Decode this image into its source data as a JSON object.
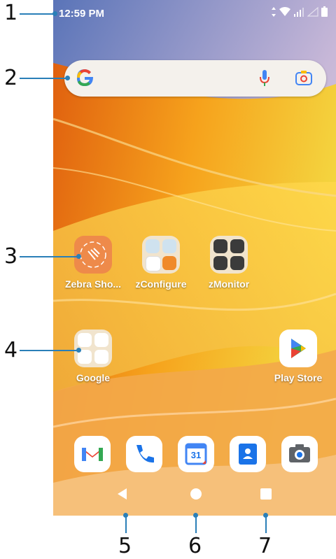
{
  "status_bar": {
    "time": "12:59 PM"
  },
  "search": {},
  "home_apps": [
    {
      "label": "Zebra Sho..."
    },
    {
      "label": "zConfigure"
    },
    {
      "label": "zMonitor"
    },
    {
      "label": "Google"
    },
    {
      "label": "Play Store"
    }
  ],
  "calendar_day": "31",
  "callouts": [
    "1",
    "2",
    "3",
    "4",
    "5",
    "6",
    "7"
  ],
  "colors": {
    "callout_line": "#2a7fb8",
    "zebra_orange": "#ee8a4a",
    "wallpaper_base": "#f2a51f"
  }
}
